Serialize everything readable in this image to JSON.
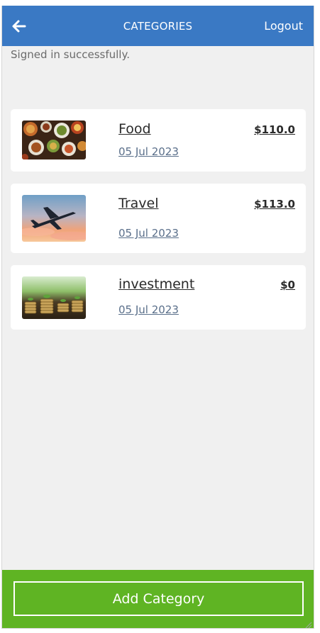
{
  "header": {
    "title": "CATEGORIES",
    "logout_label": "Logout"
  },
  "flash": {
    "message": "Signed in successfully."
  },
  "categories": [
    {
      "name": "Food",
      "date": "05 Jul 2023",
      "amount": "$110.0",
      "image": "food-photo"
    },
    {
      "name": "Travel",
      "date": "05 Jul 2023",
      "amount": "$113.0",
      "image": "airplane-photo"
    },
    {
      "name": "investment",
      "date": "05 Jul 2023",
      "amount": "$0",
      "image": "coins-plants-photo"
    }
  ],
  "footer": {
    "add_label": "Add Category"
  },
  "colors": {
    "header": "#3a79c4",
    "footer": "#5fb423",
    "background": "#f0f0f0"
  }
}
